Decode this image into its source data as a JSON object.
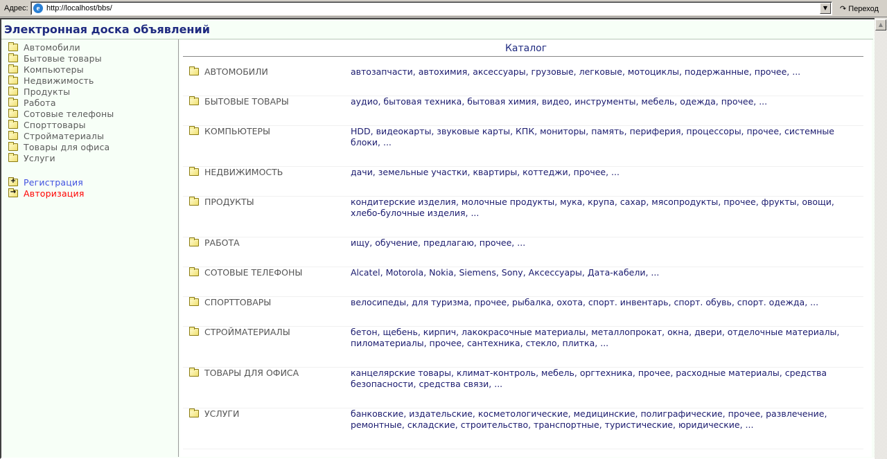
{
  "browser": {
    "address_label": "Адрес:",
    "url": "http://localhost/bbs/",
    "go_label": "Переход"
  },
  "site_title": "Электронная доска объявлений",
  "sidebar": {
    "categories": [
      "Автомобили",
      "Бытовые товары",
      "Компьютеры",
      "Недвижимость",
      "Продукты",
      "Работа",
      "Сотовые телефоны",
      "Спорттовары",
      "Стройматериалы",
      "Товары для офиса",
      "Услуги"
    ],
    "register": "Регистрация",
    "login": "Авторизация"
  },
  "catalog": {
    "title": "Каталог",
    "rows": [
      {
        "name": "АВТОМОБИЛИ",
        "subs": "автозапчасти, автохимия, аксессуары, грузовые, легковые, мотоциклы, подержанные, прочее, ..."
      },
      {
        "name": "БЫТОВЫЕ ТОВАРЫ",
        "subs": "аудио, бытовая техника, бытовая химия, видео, инструменты, мебель, одежда, прочее, ..."
      },
      {
        "name": "КОМПЬЮТЕРЫ",
        "subs": "HDD, видеокарты, звуковые карты, КПК, мониторы, память, периферия, процессоры, прочее, системные блоки, ..."
      },
      {
        "name": "НЕДВИЖИМОСТЬ",
        "subs": "дачи, земельные участки, квартиры, коттеджи, прочее, ..."
      },
      {
        "name": "ПРОДУКТЫ",
        "subs": "кондитерские изделия, молочные продукты, мука, крупа, сахар, мясопродукты, прочее, фрукты, овощи, хлебо-булочные изделия, ..."
      },
      {
        "name": "РАБОТА",
        "subs": "ищу, обучение, предлагаю, прочее, ..."
      },
      {
        "name": "СОТОВЫЕ ТЕЛЕФОНЫ",
        "subs": "Alcatel, Motorola, Nokia, Siemens, Sony, Аксессуары, Дата-кабели, ..."
      },
      {
        "name": "СПОРТТОВАРЫ",
        "subs": "велосипеды, для туризма, прочее, рыбалка, охота, спорт. инвентарь, спорт. обувь, спорт. одежда, ..."
      },
      {
        "name": "СТРОЙМАТЕРИАЛЫ",
        "subs": "бетон, щебень, кирпич, лакокрасочные материалы, металлопрокат, окна, двери, отделочные материалы, пиломатериалы, прочее, сантехника, стекло, плитка, ..."
      },
      {
        "name": "ТОВАРЫ ДЛЯ ОФИСА",
        "subs": "канцелярские товары, климат-контроль, мебель, оргтехника, прочее, расходные материалы, средства безопасности, средства связи, ..."
      },
      {
        "name": "УСЛУГИ",
        "subs": "банковские, издательские, косметологические, медицинские, полиграфические, прочее, развлечение, ремонтные, складские, строительство, транспортные, туристические, юридические, ..."
      }
    ]
  }
}
